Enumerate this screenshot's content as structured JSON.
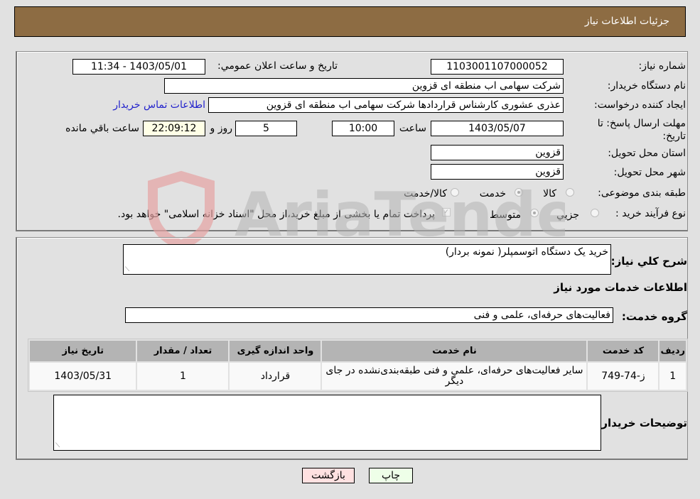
{
  "header": {
    "title": "جزئيات اطلاعات نياز"
  },
  "form": {
    "need_number": {
      "label": "شماره نیاز:",
      "value": "1103001107000052"
    },
    "announce_datetime": {
      "label": "تاريخ و ساعت اعلان عمومي:",
      "value": "1403/05/01 - 11:34"
    },
    "buyer_org": {
      "label": "نام دستگاه خریدار:",
      "value": "شرکت سهامی اب منطقه ای قزوین"
    },
    "requester": {
      "label": "ایجاد کننده درخواست:",
      "value": "عذری عشوری کارشناس قراردادها شرکت سهامی اب منطقه ای قزوین"
    },
    "buyer_contact_link": "اطلاعات تماس خریدار",
    "deadline": {
      "label": "مهلت ارسال پاسخ: تا تاریخ:",
      "date": "1403/05/07",
      "time_label": "ساعت",
      "time": "10:00",
      "days": "5",
      "days_label": "روز و",
      "remaining": "22:09:12",
      "remaining_label": "ساعت باقي مانده"
    },
    "delivery_province": {
      "label": "استان محل تحویل:",
      "value": "قزوین"
    },
    "delivery_city": {
      "label": "شهر محل تحویل:",
      "value": "قزوین"
    },
    "category": {
      "label": "طبقه بندی موضوعی:",
      "options": [
        "کالا",
        "خدمت",
        "کالا/خدمت"
      ],
      "selected": "خدمت"
    },
    "purchase_type": {
      "label": "نوع فرآیند خرید :",
      "options": [
        "جزيي",
        "متوسط"
      ],
      "selected": "متوسط",
      "treasury_note": "پرداخت تمام یا بخشی از مبلغ خرید،از محل \"اسناد خزانه اسلامی\" خواهد بود.",
      "treasury_checked": true
    }
  },
  "details": {
    "description_label": "شرح كلي نياز:",
    "description": "خرید یک دستگاه اتوسمپلر( نمونه بردار)",
    "services_heading": "اطلاعات خدمات مورد نياز",
    "service_group_label": "گروه خدمت:",
    "service_group": "فعالیت‌های حرفه‌ای، علمی و فنی",
    "table": {
      "headers": [
        "ردیف",
        "کد خدمت",
        "نام خدمت",
        "واحد اندازه گیری",
        "تعداد / مقدار",
        "تاریخ نیاز"
      ],
      "rows": [
        [
          "1",
          "ز-74-749",
          "سایر فعالیت‌های حرفه‌ای، علمی و فنی طبقه‌بندی‌نشده در جای دیگر",
          "قرارداد",
          "1",
          "1403/05/31"
        ]
      ]
    },
    "buyer_notes_label": "توضيحات خريدار:",
    "buyer_notes": ""
  },
  "buttons": {
    "print": "چاپ",
    "back": "بازگشت"
  },
  "watermark": "AriaTender.neT"
}
